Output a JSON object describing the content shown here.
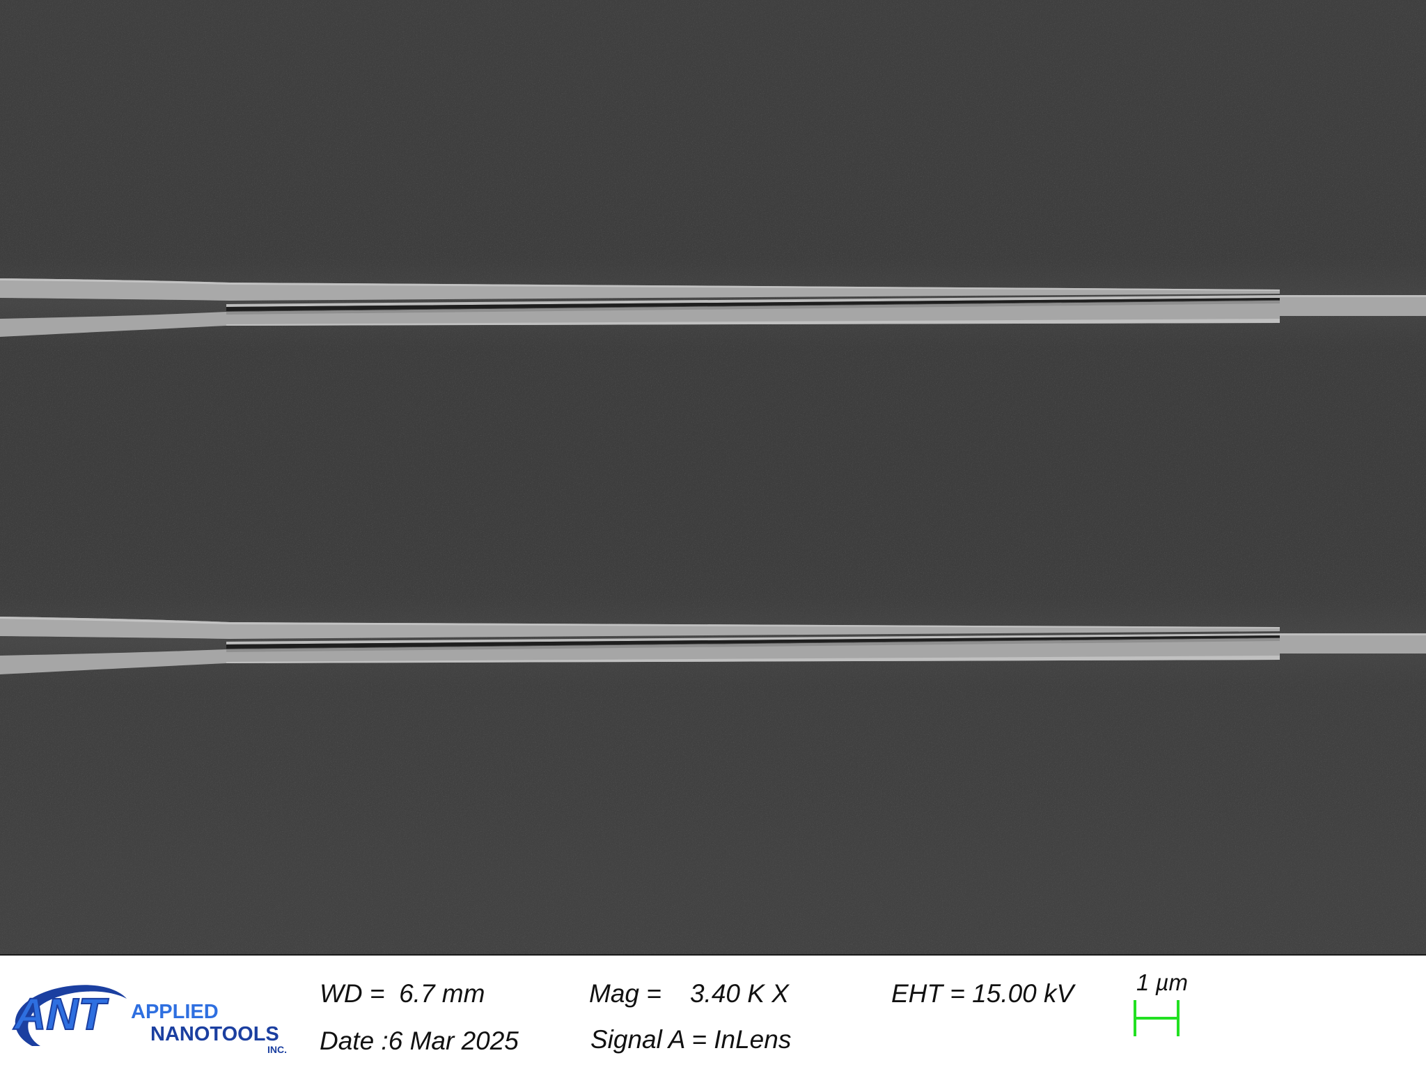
{
  "micrograph": {
    "background_color": "#414141",
    "feature_color": "#b4b4b4"
  },
  "info_bar": {
    "logo": {
      "mark": "ANT",
      "line1": "APPLIED",
      "line2": "NANOTOOLS",
      "suffix": "INC.",
      "brand_color": "#1b3fa0",
      "accent_color": "#2e6fe0"
    },
    "wd": "WD =  6.7 mm",
    "date": "Date :6 Mar 2025",
    "mag": "Mag =    3.40 K X",
    "signal": "Signal A = InLens",
    "eht": "EHT = 15.00 kV",
    "scale_bar": {
      "label": "1 µm",
      "color": "#22e022"
    }
  }
}
